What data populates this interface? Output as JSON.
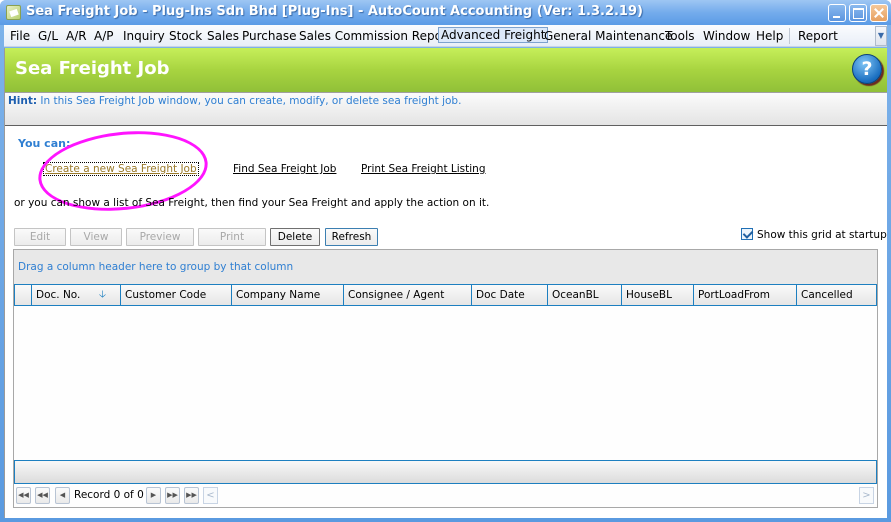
{
  "window": {
    "title": "Sea Freight Job - Plug-Ins Sdn Bhd [Plug-Ins] - AutoCount Accounting (Ver: 1.3.2.19)"
  },
  "menu": {
    "items": [
      {
        "label": "File"
      },
      {
        "label": "G/L"
      },
      {
        "label": "A/R"
      },
      {
        "label": "A/P"
      },
      {
        "label": "Inquiry"
      },
      {
        "label": "Stock"
      },
      {
        "label": "Sales"
      },
      {
        "label": "Purchase"
      },
      {
        "label": "Sales Commission Report"
      },
      {
        "label": "Advanced Freight",
        "active": true
      },
      {
        "label": "General Maintenance"
      },
      {
        "label": "Tools"
      },
      {
        "label": "Window"
      },
      {
        "label": "Help"
      },
      {
        "label": "Report"
      }
    ],
    "overflow_icon": "chevron-down-icon"
  },
  "banner": {
    "title": "Sea Freight Job",
    "help_icon": "?"
  },
  "hint": {
    "label": "Hint:",
    "text": " In this Sea Freight Job window, you can create, modify, or delete sea freight job."
  },
  "actions": {
    "you_can": "You can:",
    "links": [
      {
        "label": "Create a new Sea Freight Job"
      },
      {
        "label": "Find Sea Freight Job"
      },
      {
        "label": "Print Sea Freight Listing"
      }
    ],
    "description": "or you can show a list of Sea Freight, then find your Sea Freight and apply the action on it."
  },
  "toolbar": {
    "buttons": [
      {
        "label": "Edit",
        "enabled": false
      },
      {
        "label": "View",
        "enabled": false
      },
      {
        "label": "Preview",
        "enabled": false
      },
      {
        "label": "Print",
        "enabled": false
      },
      {
        "label": "Delete",
        "enabled": true
      },
      {
        "label": "Refresh",
        "enabled": true
      }
    ],
    "show_grid_label": "Show this grid at startup",
    "show_grid_checked": true
  },
  "grid": {
    "group_panel_text": "Drag a column header here to group by that column",
    "columns": [
      {
        "label": "Doc. No.",
        "sorted": "descending"
      },
      {
        "label": "Customer Code"
      },
      {
        "label": "Company Name"
      },
      {
        "label": "Consignee / Agent"
      },
      {
        "label": "Doc Date"
      },
      {
        "label": "OceanBL"
      },
      {
        "label": "HouseBL"
      },
      {
        "label": "PortLoadFrom"
      },
      {
        "label": "Cancelled"
      }
    ],
    "rows": [],
    "navigator": {
      "record_text": "Record 0 of 0",
      "first": "⏮",
      "prev_page": "⏪",
      "prev": "◀",
      "next": "▶",
      "next_page": "⏩",
      "last": "⏭"
    }
  }
}
